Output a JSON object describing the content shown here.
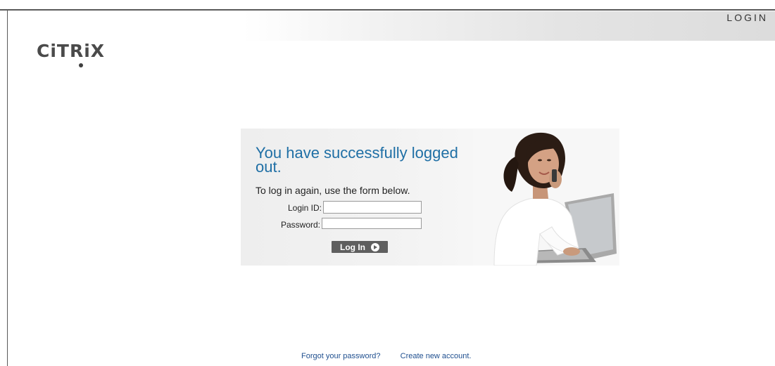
{
  "header": {
    "title": "LOGIN"
  },
  "brand": {
    "logo_text": "CiTRiX",
    "registered_mark": "·"
  },
  "panel": {
    "headline": "You have successfully logged out.",
    "subtext": "To log in again, use the form below.",
    "fields": {
      "login_id_label": "Login ID:",
      "login_id_value": "",
      "password_label": "Password:",
      "password_value": ""
    },
    "button_label": "Log In"
  },
  "footer": {
    "forgot_link": "Forgot your password?",
    "create_link": "Create new account."
  },
  "colors": {
    "accent": "#1f6fa5",
    "button": "#5f5f5f",
    "link": "#1f4f8f"
  }
}
